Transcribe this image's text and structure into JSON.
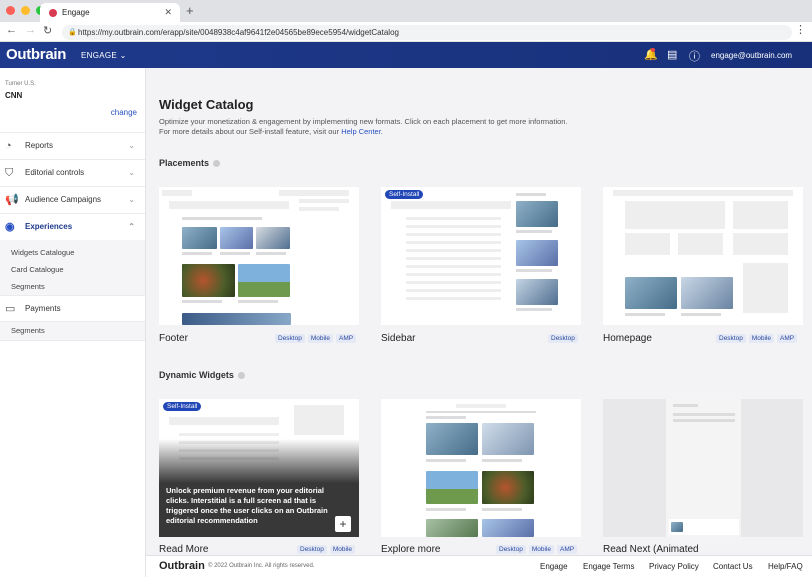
{
  "browser": {
    "tab_title": "Engage",
    "url": "https://my.outbrain.com/erapp/site/0048938c4af9641f2e04565be89ece5954/widgetCatalog"
  },
  "topnav": {
    "logo": "Outbrain",
    "product": "ENGAGE",
    "user_email": "engage@outbrain.com"
  },
  "account": {
    "publisher": "Turner U.S.",
    "name": "CNN",
    "change_label": "change"
  },
  "sidebar": {
    "items": [
      {
        "label": "Reports",
        "icon": "chart-icon"
      },
      {
        "label": "Editorial controls",
        "icon": "shield-icon"
      },
      {
        "label": "Audience Campaigns",
        "icon": "megaphone-icon"
      },
      {
        "label": "Experiences",
        "icon": "experiences-icon"
      },
      {
        "label": "Payments",
        "icon": "wallet-icon"
      }
    ],
    "experiences_sub": [
      "Widgets Catalogue",
      "Card Catalogue",
      "Segments"
    ],
    "payments_sub": [
      "Segments"
    ]
  },
  "main": {
    "title": "Widget Catalog",
    "desc_line1": "Optimize your monetization & engagement by implementing new formats. Click on each placement to get more information.",
    "desc_line2_prefix": "For more details about our Self-install feature, visit our",
    "desc_link": "Help Center.",
    "placements_title": "Placements",
    "dynamic_title": "Dynamic Widgets"
  },
  "placements": [
    {
      "label": "Footer",
      "tags": [
        "Desktop",
        "Mobile",
        "AMP"
      ],
      "badge": ""
    },
    {
      "label": "Sidebar",
      "tags": [
        "Desktop"
      ],
      "badge": "Self-Install"
    },
    {
      "label": "Homepage",
      "tags": [
        "Desktop",
        "Mobile",
        "AMP"
      ],
      "badge": ""
    }
  ],
  "dynamic": [
    {
      "label": "Read More",
      "tags": [
        "Desktop",
        "Mobile"
      ],
      "badge": "Self-Install",
      "overlay": "Unlock premium revenue from your editorial clicks. Interstitial is a full screen ad that is triggered once the user clicks on an Outbrain editorial recommendation",
      "plus": "+"
    },
    {
      "label": "Explore more",
      "tags": [
        "Desktop",
        "Mobile",
        "AMP"
      ]
    },
    {
      "label": "Read Next (Animated",
      "tags": []
    }
  ],
  "footer": {
    "logo": "Outbrain",
    "copyright": "© 2022 Outbrain Inc. All rights reserved.",
    "links": [
      "Engage",
      "Engage Terms",
      "Privacy Policy",
      "Contact Us",
      "Help/FAQ"
    ]
  },
  "colors": {
    "brand": "#1f3a8c",
    "accent": "#2a51c2",
    "badge": "#2146b6"
  }
}
